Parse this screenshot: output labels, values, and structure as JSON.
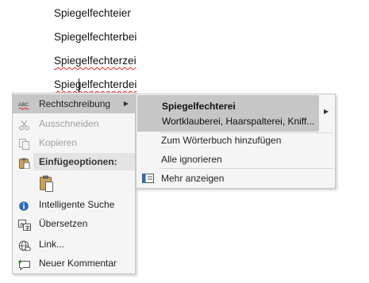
{
  "document": {
    "lines": [
      "Spiegelfechteier",
      "Spiegelfechterbei",
      "Spiegelfechterzei",
      "Spiegelfechterdei"
    ]
  },
  "context_menu": {
    "spelling_label": "Rechtschreibung",
    "cut_label": "Ausschneiden",
    "copy_label": "Kopieren",
    "paste_options_label": "Einfügeoptionen:",
    "smart_lookup_label": "Intelligente Suche",
    "translate_label": "Übersetzen",
    "link_label": "Link...",
    "new_comment_label": "Neuer Kommentar",
    "spelling_icon_text": "ABC"
  },
  "spelling_submenu": {
    "suggestion": "Spiegelfechterei",
    "synonyms": "Wortklauberei, Haarspalterei, Kniff...",
    "add_to_dictionary_label": "Zum Wörterbuch hinzufügen",
    "ignore_all_label": "Alle ignorieren",
    "show_more_label": "Mehr anzeigen"
  },
  "colors": {
    "squiggle": "#d22222",
    "menu_background": "#f5f5f5",
    "highlight": "#c6c6c6"
  }
}
